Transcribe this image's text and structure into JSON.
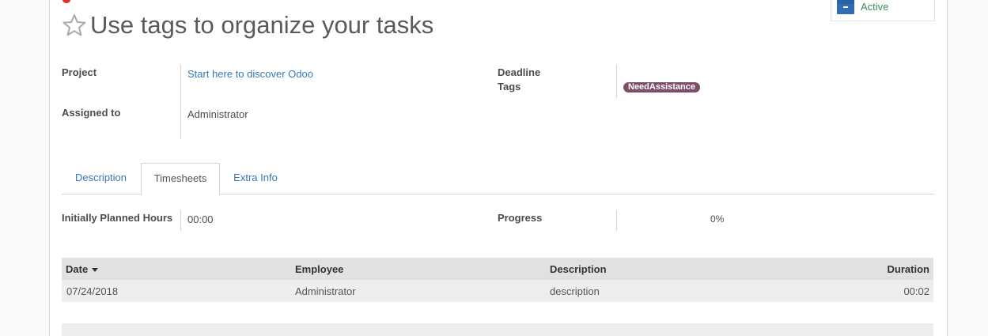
{
  "header": {
    "title": "Use tags to organize your tasks",
    "active_label": "Active"
  },
  "fields": {
    "project_label": "Project",
    "project_value": "Start here to discover Odoo",
    "assigned_label": "Assigned to",
    "assigned_value": "Administrator",
    "deadline_label": "Deadline",
    "tags_label": "Tags",
    "tag_value": "NeedAssistance"
  },
  "tabs": [
    {
      "label": "Description"
    },
    {
      "label": "Timesheets"
    },
    {
      "label": "Extra Info"
    }
  ],
  "timesheets": {
    "planned_label": "Initially Planned Hours",
    "planned_value": "00:00",
    "progress_label": "Progress",
    "progress_value": "0%"
  },
  "grid": {
    "columns": [
      "Date",
      "Employee",
      "Description",
      "Duration"
    ],
    "rows": [
      {
        "date": "07/24/2018",
        "employee": "Administrator",
        "description": "description",
        "duration": "00:02"
      }
    ]
  },
  "colors": {
    "tag": "#7c4f67",
    "active": "#3f8c63",
    "link": "#337ab7"
  },
  "icons": [
    "star-icon",
    "archive-icon",
    "sort-caret-icon"
  ]
}
